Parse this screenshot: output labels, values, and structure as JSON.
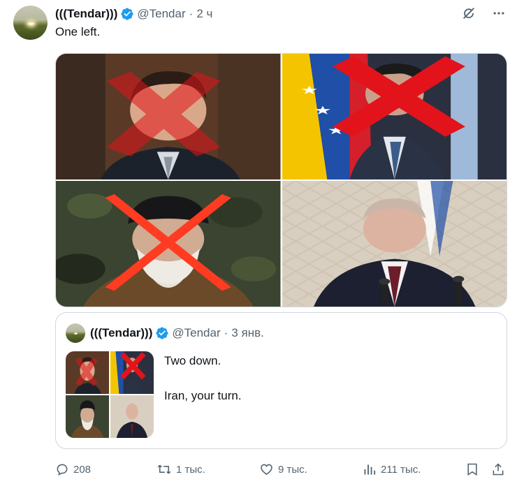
{
  "post": {
    "author_name": "(((Tendar)))",
    "handle": "@Tendar",
    "separator": "·",
    "time": "2 ч",
    "text": "One left."
  },
  "quote": {
    "author_name": "(((Tendar)))",
    "handle": "@Tendar",
    "separator": "·",
    "date": "3 янв.",
    "line1": "Two down.",
    "line2": "Iran, your turn."
  },
  "actions": {
    "replies": "208",
    "reposts": "1 тыс.",
    "likes": "9 тыс.",
    "views": "211 тыс."
  },
  "icons": {
    "verified": "verified-badge-icon",
    "grok": "grok-icon",
    "more": "more-icon",
    "reply": "reply-icon",
    "repost": "repost-icon",
    "like": "like-icon",
    "views": "views-icon",
    "bookmark": "bookmark-icon",
    "share": "share-icon"
  },
  "colors": {
    "verified_blue": "#1d9bf0",
    "muted_text": "#536471",
    "strike_red": "#e3131b"
  }
}
